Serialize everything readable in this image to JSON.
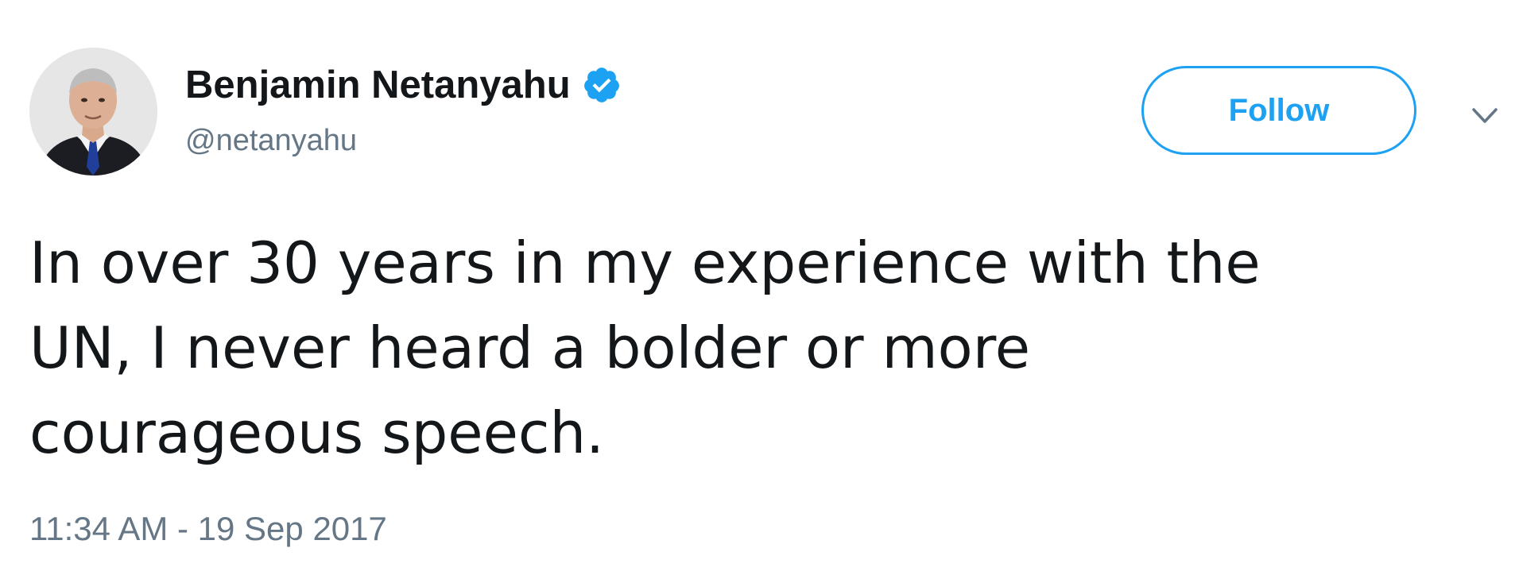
{
  "author": {
    "display_name": "Benjamin Netanyahu",
    "handle": "@netanyahu",
    "verified": true,
    "avatar_icon": "profile-photo"
  },
  "actions": {
    "follow_label": "Follow",
    "more_icon": "chevron-down-icon"
  },
  "tweet": {
    "text": "In over 30 years in my experience with the\nUN, I never heard a bolder or more\ncourageous speech.",
    "timestamp": "11:34 AM - 19 Sep 2017"
  },
  "colors": {
    "accent": "#1da1f2",
    "secondary_text": "#657786",
    "primary_text": "#14171a"
  }
}
